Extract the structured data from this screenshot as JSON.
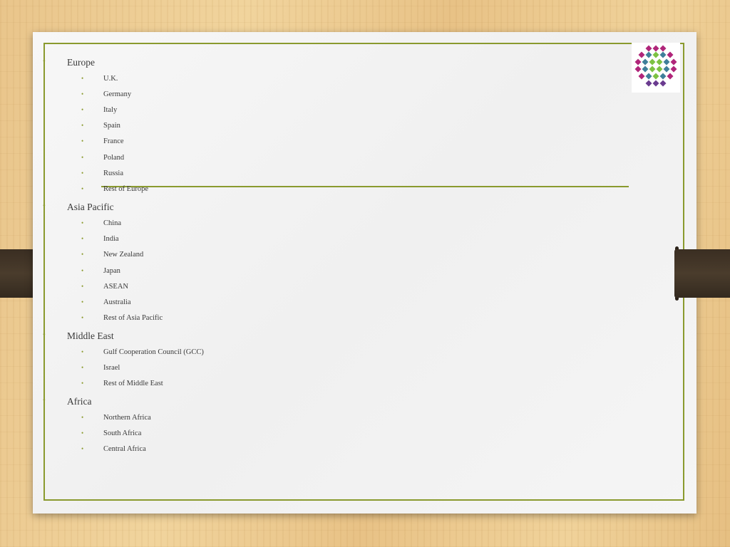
{
  "regions": [
    {
      "name": "Europe",
      "items": [
        "U.K.",
        "Germany",
        "Italy",
        "Spain",
        "France",
        "Poland",
        "Russia",
        "Rest of Europe"
      ]
    },
    {
      "name": "Asia Pacific",
      "items": [
        "China",
        "India",
        "New Zealand",
        "Japan",
        "ASEAN",
        "Australia",
        "Rest of Asia Pacific"
      ]
    },
    {
      "name": "Middle East",
      "items": [
        "Gulf Cooperation Council (GCC)",
        "Israel",
        "Rest of Middle East"
      ]
    },
    {
      "name": "Africa",
      "items": [
        "Northern Africa",
        "South Africa",
        "Central Africa"
      ]
    }
  ],
  "bullet_glyph": "•",
  "colors": {
    "accent": "#8a9a2e",
    "text": "#3a3a3a",
    "logo_magenta": "#b0257a",
    "logo_teal": "#3f7f9a",
    "logo_green": "#7cc242",
    "logo_purple": "#6a3b8f"
  }
}
